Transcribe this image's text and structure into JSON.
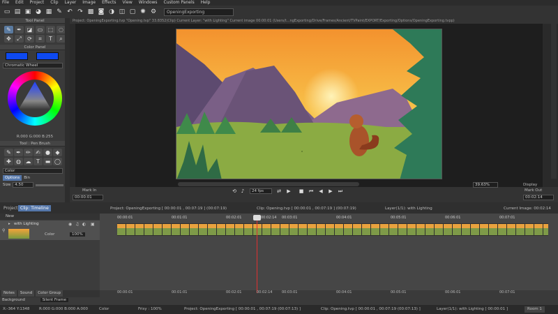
{
  "menu": [
    "File",
    "Edit",
    "Project",
    "Clip",
    "Layer",
    "Image",
    "Effects",
    "View",
    "Windows",
    "Custom Panels",
    "Help"
  ],
  "toolbar": {
    "project_select": "OpeningExporting"
  },
  "left_panel": {
    "tool_panel_title": "Tool Panel",
    "color_panel_title": "Color Panel",
    "wheel_label": "Chromatic Wheel",
    "rgb_readout": "R:000  G:000  B:255",
    "brush_title": "Tool : Pen Brush",
    "color_label": "Color",
    "options_tab": "Options",
    "bin_tab": "Bin",
    "size_label": "Size",
    "size_value": "4.50",
    "swatch_color": "#0e49f0"
  },
  "viewer": {
    "path": "Project: OpeningExporting.tvp \"Opening.tvp\" 33.8352(Clip) Current Layer: \"with Lighting\" Current image 00:00:01 (Users/t...ngExporting/Drive/Frames/Ancient/TVPaint/EXPORT/Exporting/Options/OpeningExporting.tvpp)",
    "mark_in": "Mark In",
    "mark_in_tc": "00:00:01",
    "fps": "24 fps",
    "zoom": "39.63%",
    "display": "Display",
    "mark_out": "Mark Out",
    "mark_out_tc": "00:02:14"
  },
  "timeline": {
    "project_tab": "Project",
    "clip_tab": "Clip: Timeline",
    "project_info": "Project: OpeningExporting [ 00:00:01 , 00:07:19 ] (00:07:19)",
    "clip_info": "Clip: Opening.tvp [ 00:00:01 , 00:07:19 ] (00:07:19)",
    "layer_info": "Layer(1/1): with Lighting",
    "current_image": "Current Image: 00:02:14",
    "layer_new": "New",
    "layer_name": "with Lighting",
    "layer_color": "Color",
    "layer_opacity": "100%",
    "ruler": [
      "00:00:01",
      "00:01:01",
      "00:02:01",
      "00:02:14",
      "00:03:01",
      "00:04:01",
      "00:05:01",
      "00:06:01",
      "00:07:01"
    ],
    "bottom_tabs": [
      "Notes",
      "Sound",
      "Color Group"
    ],
    "background_label": "Background",
    "background_value": "Silent Frame"
  },
  "status": {
    "coords": "X:-364  Y:1348",
    "rgba": "R:000 G:000 B:000 A:000",
    "color": "Color",
    "fps": "Frisy : 100%",
    "project": "Project: OpeningExporting [ 00:00:01 , 00:07:19 (00:07:13) ]",
    "clip": "Clip: Opening.tvp [ 00:00:01 , 00:07:19 (00:07:13) ]",
    "layer": "Layer(1/1): with Lighting [ 00:00:01 ]",
    "room": "Room 1"
  }
}
